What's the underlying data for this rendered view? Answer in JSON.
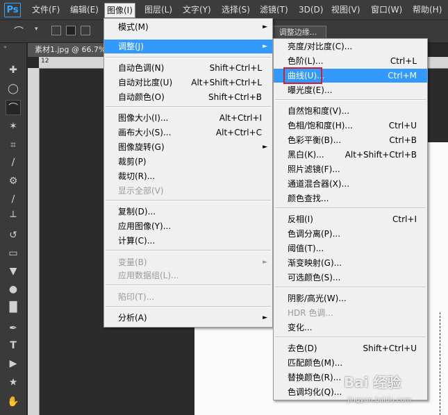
{
  "app": {
    "logo": "Ps"
  },
  "menubar": {
    "items": [
      "文件(F)",
      "编辑(E)",
      "图像(I)",
      "图层(L)",
      "文字(Y)",
      "选择(S)",
      "滤镜(T)",
      "3D(D)",
      "视图(V)",
      "窗口(W)",
      "帮助(H)"
    ],
    "active": "图像(I)"
  },
  "options": {
    "refine_edge": "调整边缘..."
  },
  "document": {
    "tab": "素材1.jpg @ 66.7%"
  },
  "ruler": {
    "h_labels": [
      "12"
    ]
  },
  "image_menu": [
    {
      "label": "模式(M)",
      "arrow": true
    },
    {
      "label": "调整(J)",
      "arrow": true,
      "highlighted": true
    },
    {
      "label": "自动色调(N)",
      "shortcut": "Shift+Ctrl+L"
    },
    {
      "label": "自动对比度(U)",
      "shortcut": "Alt+Shift+Ctrl+L"
    },
    {
      "label": "自动颜色(O)",
      "shortcut": "Shift+Ctrl+B"
    },
    {
      "label": "图像大小(I)...",
      "shortcut": "Alt+Ctrl+I"
    },
    {
      "label": "画布大小(S)...",
      "shortcut": "Alt+Ctrl+C"
    },
    {
      "label": "图像旋转(G)",
      "arrow": true
    },
    {
      "label": "裁剪(P)"
    },
    {
      "label": "裁切(R)..."
    },
    {
      "label": "显示全部(V)",
      "disabled": true
    },
    {
      "label": "复制(D)..."
    },
    {
      "label": "应用图像(Y)..."
    },
    {
      "label": "计算(C)..."
    },
    {
      "label": "变量(B)",
      "arrow": true,
      "disabled": true
    },
    {
      "label": "应用数据组(L)...",
      "disabled": true
    },
    {
      "label": "陷印(T)...",
      "disabled": true
    },
    {
      "label": "分析(A)",
      "arrow": true
    }
  ],
  "adjust_menu": [
    {
      "label": "亮度/对比度(C)..."
    },
    {
      "label": "色阶(L)...",
      "shortcut": "Ctrl+L"
    },
    {
      "label": "曲线(U)...",
      "shortcut": "Ctrl+M",
      "highlighted": true
    },
    {
      "label": "曝光度(E)..."
    },
    {
      "label": "自然饱和度(V)..."
    },
    {
      "label": "色相/饱和度(H)...",
      "shortcut": "Ctrl+U"
    },
    {
      "label": "色彩平衡(B)...",
      "shortcut": "Ctrl+B"
    },
    {
      "label": "黑白(K)...",
      "shortcut": "Alt+Shift+Ctrl+B"
    },
    {
      "label": "照片滤镜(F)..."
    },
    {
      "label": "通道混合器(X)..."
    },
    {
      "label": "颜色查找..."
    },
    {
      "label": "反相(I)",
      "shortcut": "Ctrl+I"
    },
    {
      "label": "色调分离(P)..."
    },
    {
      "label": "阈值(T)..."
    },
    {
      "label": "渐变映射(G)..."
    },
    {
      "label": "可选颜色(S)..."
    },
    {
      "label": "阴影/高光(W)..."
    },
    {
      "label": "HDR 色调...",
      "disabled": true
    },
    {
      "label": "变化..."
    },
    {
      "label": "去色(D)",
      "shortcut": "Shift+Ctrl+U"
    },
    {
      "label": "匹配颜色(M)..."
    },
    {
      "label": "替换颜色(R)..."
    },
    {
      "label": "色调均化(Q)..."
    }
  ],
  "watermark": {
    "text": "Bai 经验",
    "sub": "jingyan.baidu.com"
  },
  "colors": {
    "highlight": "#3399ff",
    "menu_bg": "#f0f0f0",
    "annotation_box": "#d0202a",
    "ps_blue": "#31a8ff"
  }
}
